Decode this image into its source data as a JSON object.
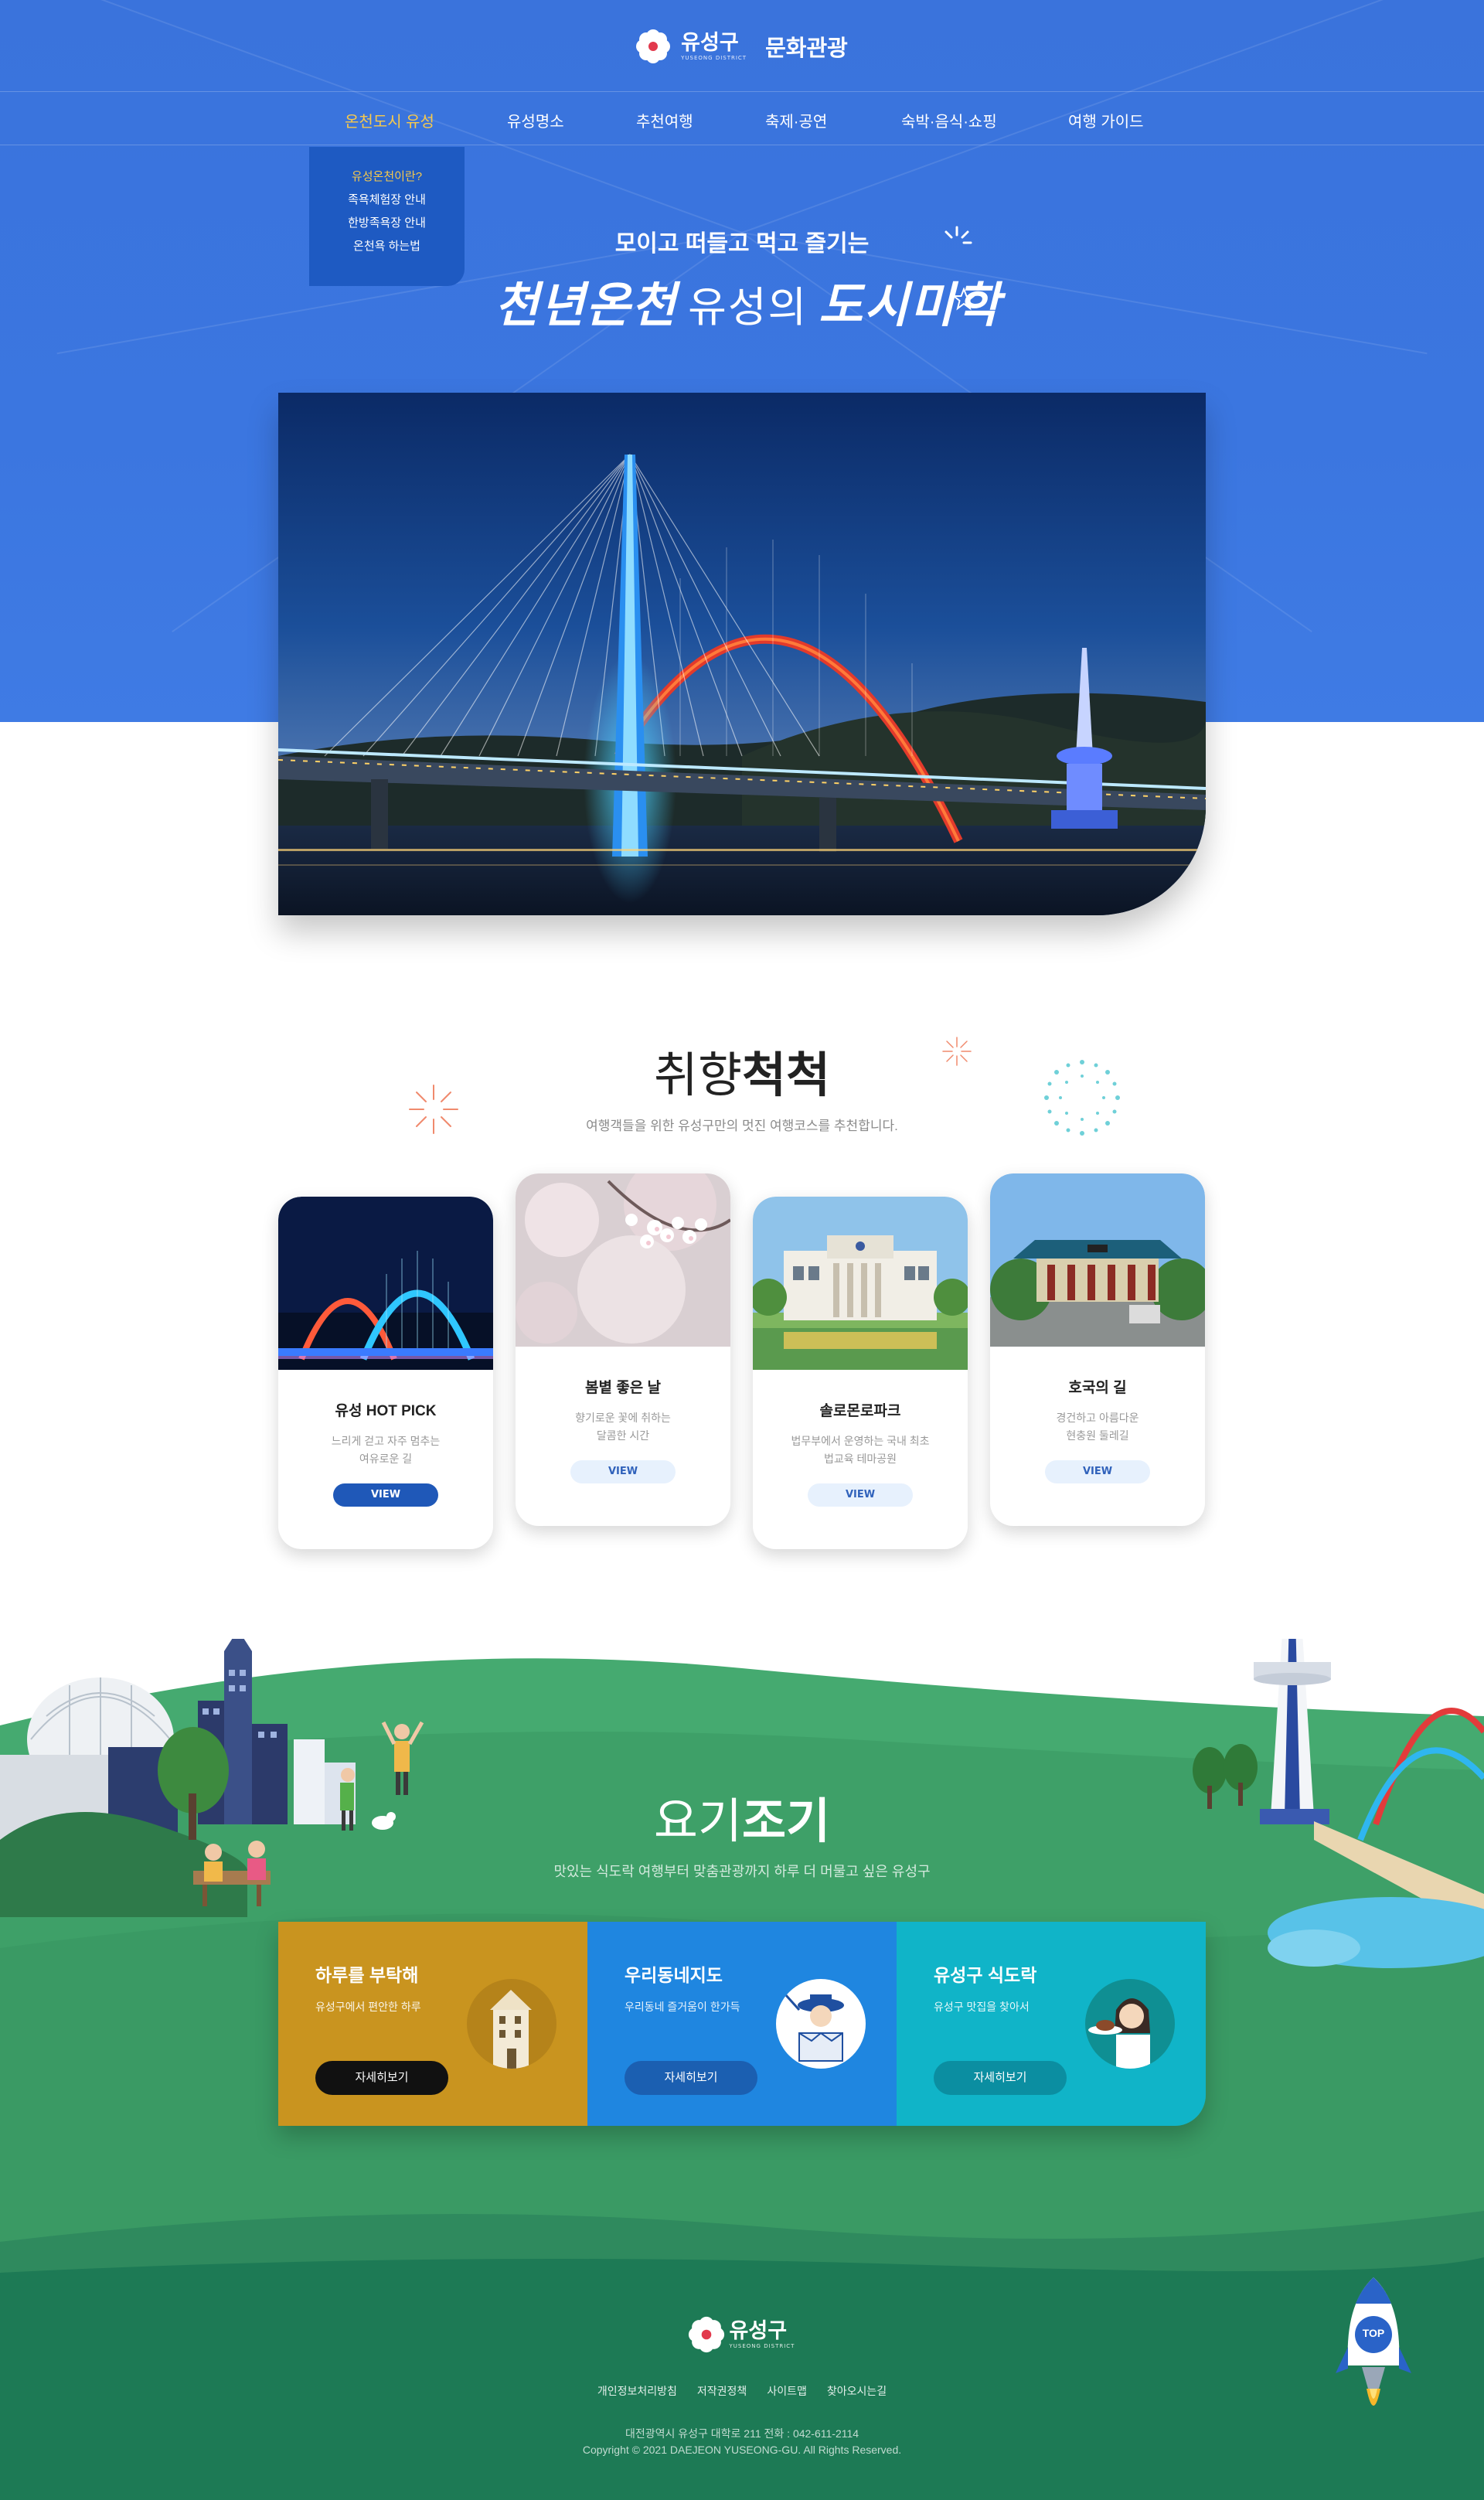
{
  "header": {
    "brand_name": "유성구",
    "brand_sub": "YUSEONG DISTRICT",
    "service_name": "문화관광"
  },
  "nav": {
    "items": [
      {
        "label": "온천도시 유성",
        "active": true
      },
      {
        "label": "유성명소"
      },
      {
        "label": "추천여행"
      },
      {
        "label": "축제·공연"
      },
      {
        "label": "숙박·음식·쇼핑"
      },
      {
        "label": "여행 가이드"
      }
    ],
    "submenu": [
      {
        "label": "유성온천이란?",
        "active": true
      },
      {
        "label": "족욕체험장 안내"
      },
      {
        "label": "한방족욕장 안내"
      },
      {
        "label": "온천욕 하는법"
      }
    ]
  },
  "hero": {
    "slogan_top": "모이고 떠들고 먹고 즐기는",
    "slogan_left": "천년온천",
    "slogan_mid": "유성의",
    "slogan_right": "도시미학",
    "photo_icon": "expo-bridge-night-photo"
  },
  "taste": {
    "title_light": "취향",
    "title_bold": "척척",
    "desc": "여행객들을 위한 유성구만의 멋진 여행코스를 추천합니다.",
    "cards": [
      {
        "title": "유성 HOT PICK",
        "desc": "느리게 걷고 자주 멈추는\n여유로운 길",
        "button": "VIEW",
        "thumb_icon": "bridge-night-photo"
      },
      {
        "title": "봄볕 좋은 날",
        "desc": "향기로운 꽃에 취하는\n달콤한 시간",
        "button": "VIEW",
        "thumb_icon": "cherry-blossom-photo"
      },
      {
        "title": "솔로몬로파크",
        "desc": "법무부에서 운영하는 국내 최초\n법교육 테마공원",
        "button": "VIEW",
        "thumb_icon": "law-park-building-photo"
      },
      {
        "title": "호국의 길",
        "desc": "경건하고 아름다운\n현충원 둘레길",
        "button": "VIEW",
        "thumb_icon": "memorial-hall-photo"
      }
    ]
  },
  "yogi": {
    "title_light": "요기",
    "title_bold": "조기",
    "desc": "맛있는 식도락 여행부터 맞춤관광까지 하루 더 머물고 싶은 유성구",
    "panels": [
      {
        "title": "하루를 부탁해",
        "desc": "유성구에서 편안한 하루",
        "button": "자세히보기",
        "color": "#c9941f",
        "button_color": "#111111",
        "icon": "hotel-building-icon"
      },
      {
        "title": "우리동네지도",
        "desc": "우리동네 즐거움이 한가득",
        "button": "자세히보기",
        "color": "#1f86e0",
        "button_color": "#1b5fb1",
        "icon": "explorer-map-icon"
      },
      {
        "title": "유성구 식도락",
        "desc": "유성구 맛집을 찾아서",
        "button": "자세히보기",
        "color": "#10b4c8",
        "button_color": "#0b8ea1",
        "icon": "chef-dish-icon"
      }
    ]
  },
  "footer": {
    "brand_name": "유성구",
    "brand_sub": "YUSEONG DISTRICT",
    "links": [
      "개인정보처리방침",
      "저작권정책",
      "사이트맵",
      "찾아오시는길"
    ],
    "address": "대전광역시 유성구 대학로 211 전화 : 042-611-2114",
    "copyright": "Copyright © 2021 DAEJEON YUSEONG-GU. All Rights Reserved.",
    "top_label": "TOP"
  },
  "colors": {
    "hero_blue": "#3a73dc",
    "accent_yellow": "#f7c94c",
    "grass_light": "#3da56c",
    "grass_dark": "#1d7a55"
  }
}
